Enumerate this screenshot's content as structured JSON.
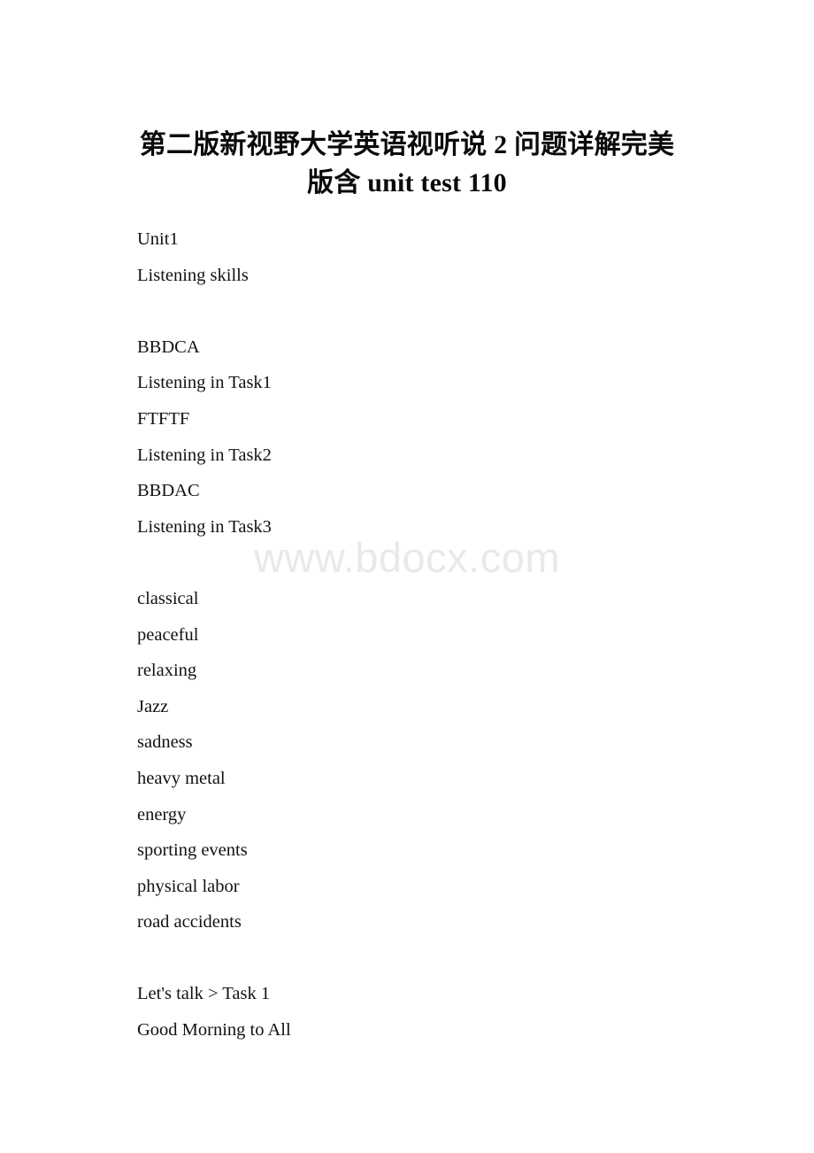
{
  "document": {
    "title_lines": [
      "第二版新视野大学英语视听说 2 问题详解完美",
      "版含 unit test 110"
    ],
    "body_lines": [
      "Unit1",
      "Listening skills",
      "",
      "BBDCA",
      "Listening in Task1",
      "FTFTF",
      "Listening in Task2",
      "BBDAC",
      "Listening in Task3",
      "",
      "classical",
      "peaceful",
      "relaxing",
      "Jazz",
      "sadness",
      "heavy metal",
      "energy",
      "sporting events",
      "physical labor",
      "road accidents",
      "",
      "Let's talk > Task 1",
      "Good Morning to All"
    ],
    "watermark": "www.bdocx.com",
    "colors": {
      "page_background": "#ffffff",
      "text": "#121212",
      "title": "#0a0a0a",
      "watermark": "#e9e9e9"
    }
  }
}
